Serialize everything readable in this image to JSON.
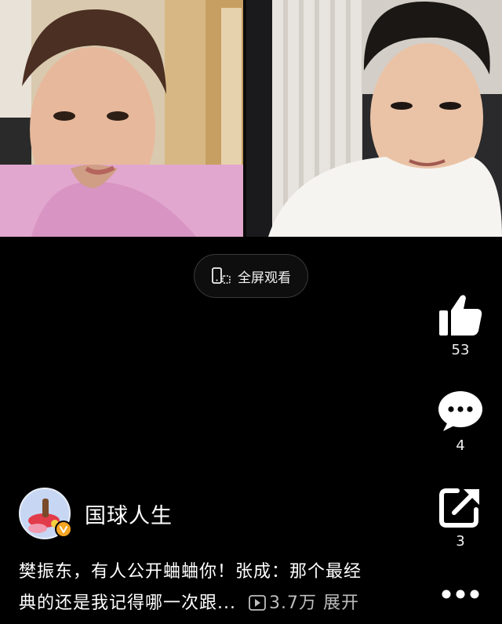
{
  "video": {
    "fullscreen_label": "全屏观看"
  },
  "actions": {
    "like_count": "53",
    "comment_count": "4",
    "share_count": "3"
  },
  "author": {
    "name": "国球人生"
  },
  "caption": {
    "line1": "樊振东，有人公开蛐蛐你！张成：那个最经",
    "line2": "典的还是我记得哪一次跟...",
    "views": "3.7万",
    "expand_label": "展开"
  },
  "icons": {
    "like": "thumbs-up-icon",
    "comment": "chat-bubble-icon",
    "share": "share-icon",
    "more": "more-dots-icon",
    "fullscreen": "phone-rotate-icon",
    "views": "play-icon"
  },
  "colors": {
    "background": "#000000",
    "text": "#ffffff",
    "muted": "#bdbdbd",
    "badge": "#f5a623"
  }
}
